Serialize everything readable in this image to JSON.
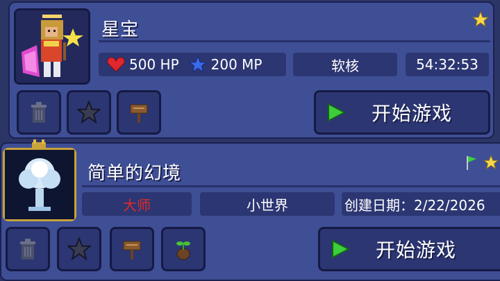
{
  "character": {
    "name": "星宝",
    "hp": "500 HP",
    "mp": "200 MP",
    "difficulty": "软核",
    "playtime": "54:32:53",
    "play_label": "开始游戏"
  },
  "world": {
    "name": "简单的幻境",
    "difficulty": "大师",
    "size": "小世界",
    "created": "创建日期：2/22/2026",
    "play_label": "开始游戏"
  },
  "colors": {
    "panel": "#3f4f96",
    "box": "#2c3672",
    "master_red": "#e02a2a",
    "play_green": "#3ccf3a",
    "star_gold": "#f5c542"
  },
  "icons": [
    "trash-icon",
    "star-icon",
    "sign-icon",
    "seed-icon",
    "play-icon",
    "heart-icon",
    "mana-star-icon",
    "flag-icon",
    "favorite-star-icon"
  ]
}
